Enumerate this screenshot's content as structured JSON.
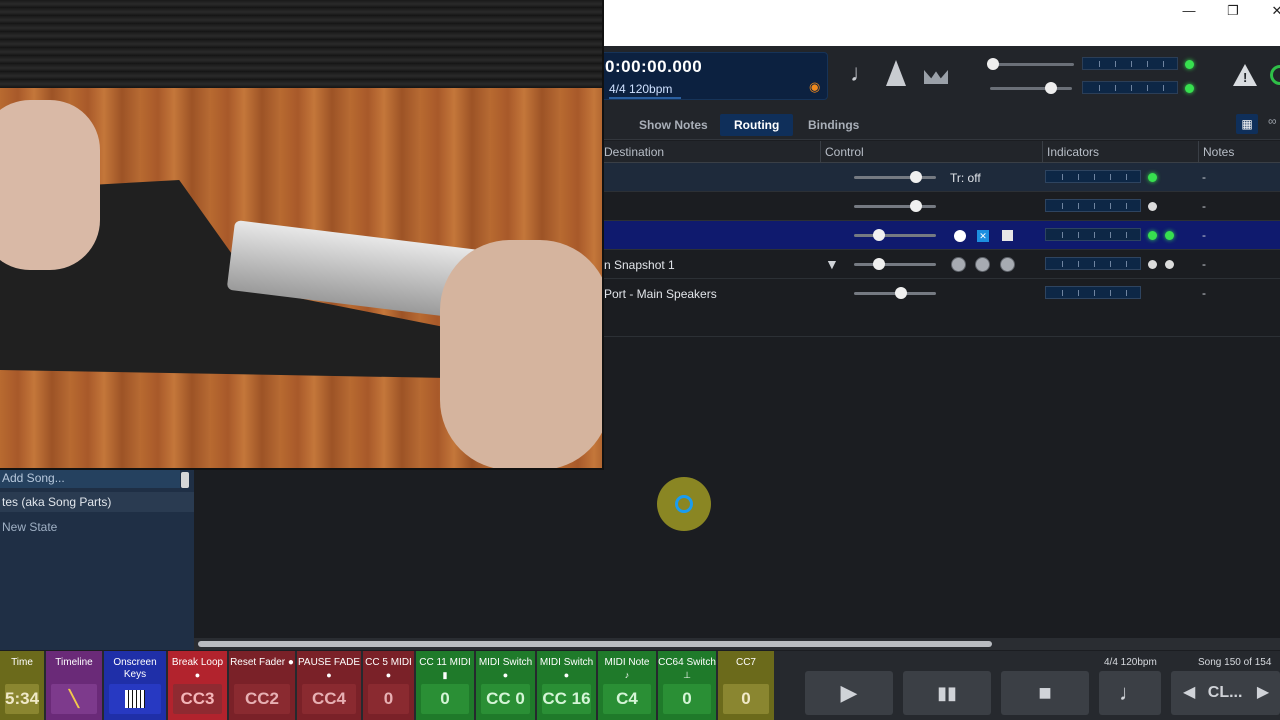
{
  "window": {
    "minimize_glyph": "—",
    "restore_glyph": "❐",
    "close_glyph": "✕"
  },
  "transport": {
    "time": "0:00:00.000",
    "signature": "4/4 120bpm",
    "icons": [
      "note-icon",
      "metronome-icon",
      "crown-icon",
      "warning-icon",
      "power-icon"
    ],
    "tempo_note": "♩"
  },
  "tabs": [
    {
      "label": "Show Notes",
      "active": false
    },
    {
      "label": "Routing",
      "active": true
    },
    {
      "label": "Bindings",
      "active": false
    }
  ],
  "table": {
    "columns": [
      "Destination",
      "Control",
      "Indicators",
      "Notes"
    ],
    "rows": [
      {
        "destination": "",
        "control_text": "Tr: off",
        "slider": 0.74,
        "leds": [
          "green"
        ],
        "notes": "-"
      },
      {
        "destination": "",
        "control_text": "",
        "slider": 0.74,
        "leds": [
          "white"
        ],
        "notes": "-"
      },
      {
        "destination": "",
        "control_text": "",
        "slider": 0.3,
        "leds": [
          "green",
          "green"
        ],
        "notes": "-"
      },
      {
        "destination": "n Snapshot 1",
        "control_text": "",
        "slider": 0.3,
        "leds": [
          "white",
          "white"
        ],
        "notes": "-"
      },
      {
        "destination": "Port - Main Speakers",
        "control_text": "",
        "slider": 0.57,
        "leds": [],
        "notes": "-"
      }
    ]
  },
  "song_panel": {
    "add_song": "Add Song...",
    "states_header": "tes (aka Song Parts)",
    "new_state": "New State"
  },
  "bottom_bar": {
    "buttons": [
      {
        "label": "Time",
        "value": "5:34",
        "bg": "#6b6a1b",
        "valbg": "#8a8630",
        "valcolor": "#f0e9c8",
        "ind": ""
      },
      {
        "label": "Timeline",
        "value": "",
        "bg": "#6a2a78",
        "valbg": "#7d3a8c",
        "valcolor": "#ffffff",
        "ind": ""
      },
      {
        "label": "Onscreen Keys",
        "value": "",
        "bg": "#1f2fa8",
        "valbg": "#2739c2",
        "valcolor": "#ffffff",
        "ind": ""
      },
      {
        "label": "Break Loop",
        "value": "CC3",
        "bg": "#b2232d",
        "valbg": "#8f2a31",
        "valcolor": "#f3b5b8",
        "ind": "●"
      },
      {
        "label": "Reset Fader ●",
        "value": "CC2",
        "bg": "#7a2128",
        "valbg": "#8a2a30",
        "valcolor": "#e7b0b3",
        "ind": ""
      },
      {
        "label": "PAUSE FADE",
        "value": "CC4",
        "bg": "#7a2128",
        "valbg": "#8a2a30",
        "valcolor": "#e7b0b3",
        "ind": "●"
      },
      {
        "label": "CC 5 MIDI",
        "value": "0",
        "bg": "#7a2128",
        "valbg": "#8a2a30",
        "valcolor": "#e7b0b3",
        "ind": "●"
      },
      {
        "label": "CC 11 MIDI",
        "value": "0",
        "bg": "#1f7a2a",
        "valbg": "#2a8f35",
        "valcolor": "#d4f5d6",
        "ind": "▮"
      },
      {
        "label": "MIDI Switch",
        "value": "CC 0",
        "bg": "#1f7a2a",
        "valbg": "#2a8f35",
        "valcolor": "#d4f5d6",
        "ind": "●"
      },
      {
        "label": "MIDI Switch",
        "value": "CC 16",
        "bg": "#1f7a2a",
        "valbg": "#2a8f35",
        "valcolor": "#d4f5d6",
        "ind": "●"
      },
      {
        "label": "MIDI Note",
        "value": "C4",
        "bg": "#1f7a2a",
        "valbg": "#2a8f35",
        "valcolor": "#d4f5d6",
        "ind": "♪"
      },
      {
        "label": "CC64 Switch",
        "value": "0",
        "bg": "#1f7a2a",
        "valbg": "#2a8f35",
        "valcolor": "#d4f5d6",
        "ind": "⊥"
      },
      {
        "label": "CC7",
        "value": "0",
        "bg": "#6b6a1b",
        "valbg": "#8a8630",
        "valcolor": "#f0e9c8",
        "ind": ""
      }
    ],
    "signature": "4/4 120bpm",
    "song_counter": "Song 150 of 154",
    "play_glyph": "▶",
    "pause_glyph": "▮▮",
    "stop_glyph": "■",
    "note_glyph": "♩",
    "prev_glyph": "◀",
    "next_glyph": "▶",
    "song_short": "CL..."
  }
}
